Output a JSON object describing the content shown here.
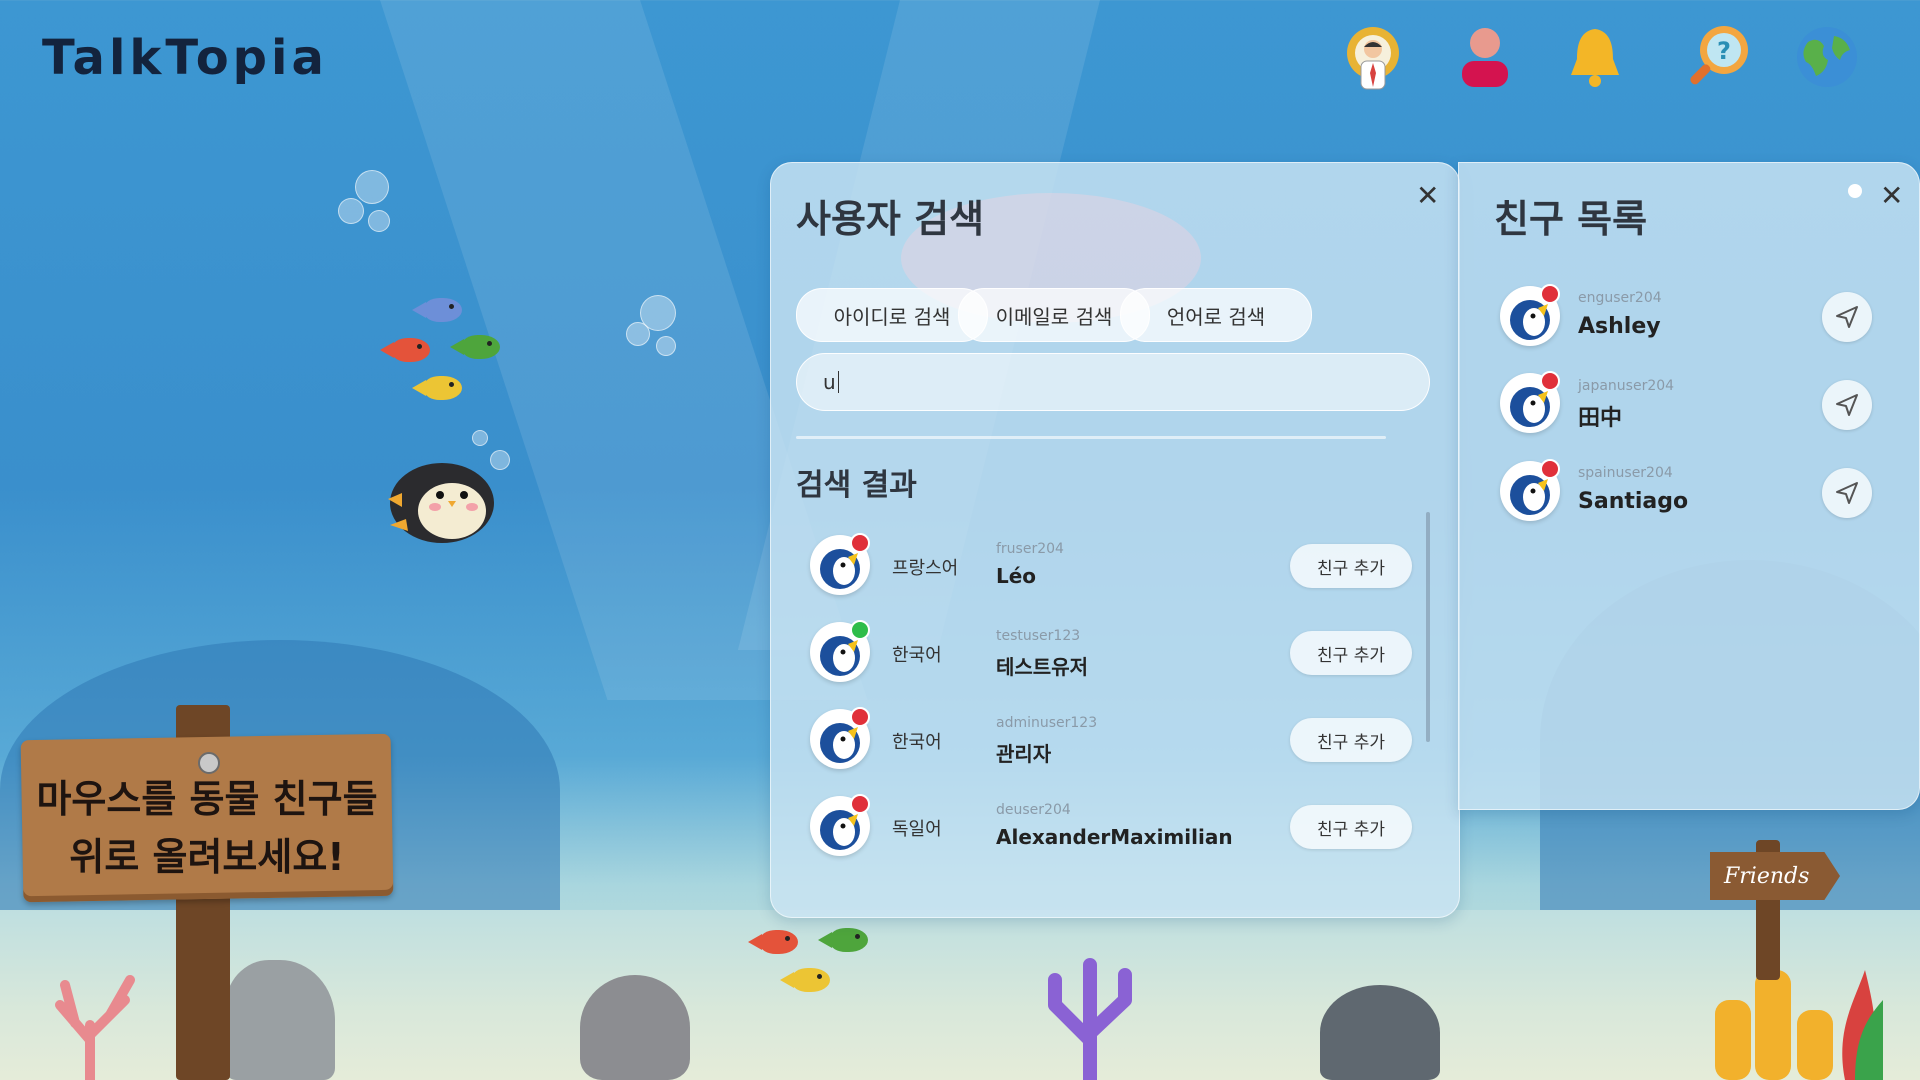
{
  "app": {
    "logo": "TalkTopia"
  },
  "header_icons": [
    "settings-profile-icon",
    "user-icon",
    "bell-icon",
    "help-icon",
    "globe-icon"
  ],
  "search_panel": {
    "title": "사용자 검색",
    "tabs": [
      "아이디로 검색",
      "이메일로 검색",
      "언어로 검색"
    ],
    "search_value": "u",
    "results_title": "검색 결과",
    "add_label": "친구 추가",
    "results": [
      {
        "lang": "프랑스어",
        "id": "fruser204",
        "name": "Léo",
        "status": "offline"
      },
      {
        "lang": "한국어",
        "id": "testuser123",
        "name": "테스트유저",
        "status": "online"
      },
      {
        "lang": "한국어",
        "id": "adminuser123",
        "name": "관리자",
        "status": "offline"
      },
      {
        "lang": "독일어",
        "id": "deuser204",
        "name": "AlexanderMaximilian",
        "status": "offline"
      }
    ]
  },
  "friends_panel": {
    "title": "친구 목록",
    "friends": [
      {
        "id": "enguser204",
        "name": "Ashley",
        "status": "offline"
      },
      {
        "id": "japanuser204",
        "name": "田中",
        "status": "offline"
      },
      {
        "id": "spainuser204",
        "name": "Santiago",
        "status": "offline"
      }
    ]
  },
  "sign": {
    "line1": "마우스를 동물 친구들",
    "line2": "위로 올려보세요!"
  },
  "friends_sign": "Friends",
  "colors": {
    "online": "#2ebd4a",
    "offline": "#e0303a",
    "accent": "#13233d"
  }
}
